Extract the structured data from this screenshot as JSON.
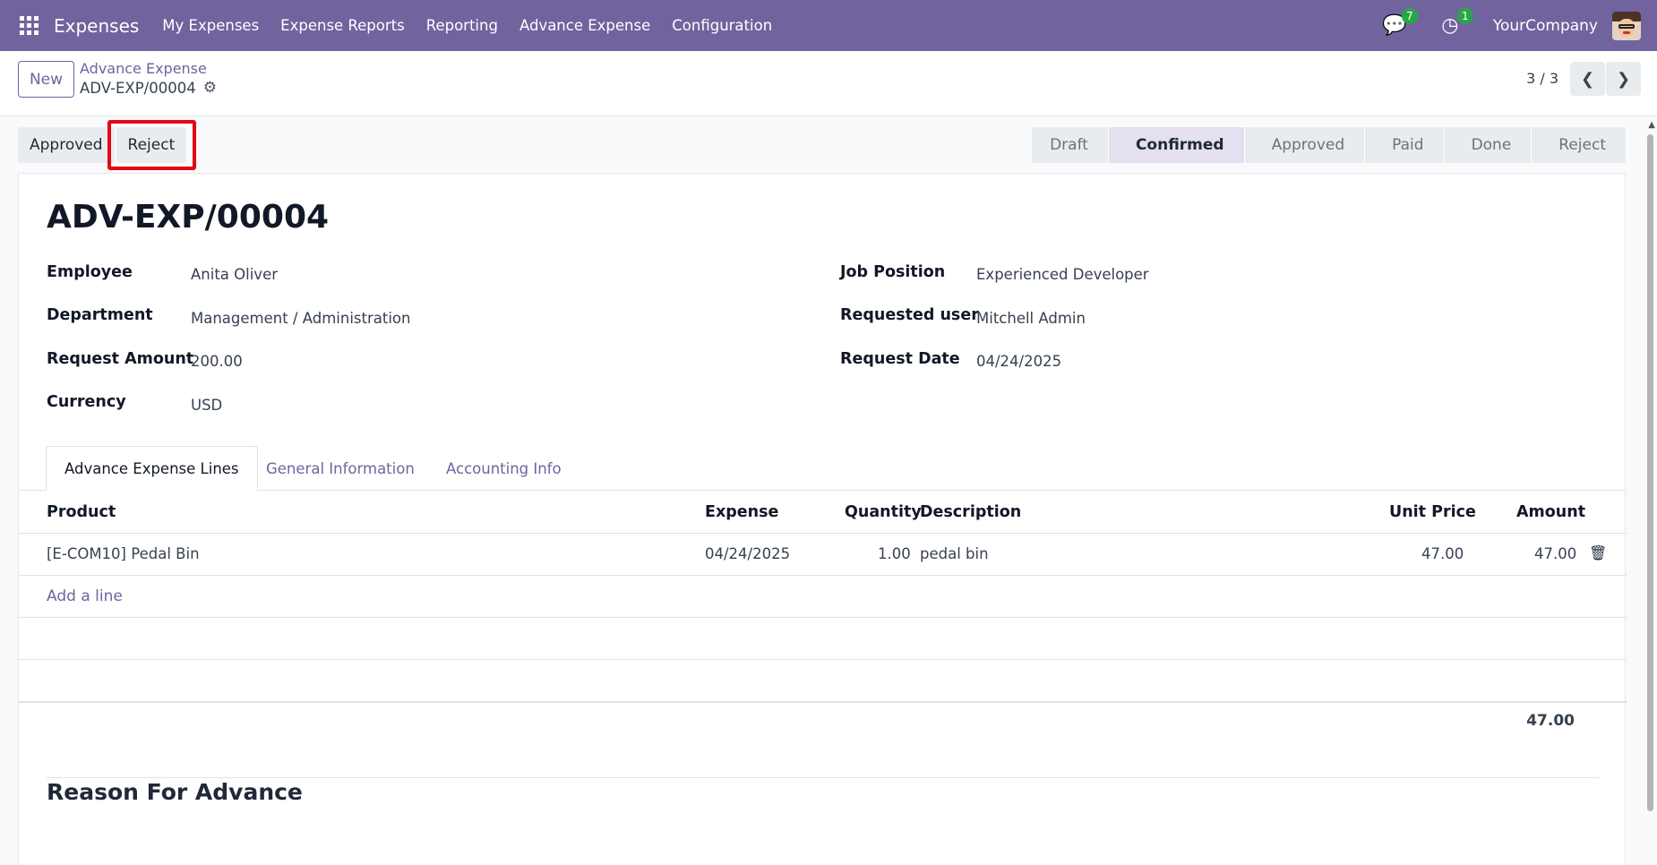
{
  "navbar": {
    "app_name": "Expenses",
    "menu": [
      "My Expenses",
      "Expense Reports",
      "Reporting",
      "Advance Expense",
      "Configuration"
    ],
    "messages_count": "7",
    "activities_count": "1",
    "company": "YourCompany",
    "color": "#71639e"
  },
  "control": {
    "new_label": "New",
    "breadcrumb_parent": "Advance Expense",
    "breadcrumb_current": "ADV-EXP/00004",
    "pager": "3 / 3"
  },
  "actions": {
    "approved_label": "Approved",
    "reject_label": "Reject"
  },
  "statusbar": {
    "stages": [
      "Draft",
      "Confirmed",
      "Approved",
      "Paid",
      "Done",
      "Reject"
    ],
    "active": "Confirmed"
  },
  "form": {
    "title": "ADV-EXP/00004",
    "left_fields": [
      {
        "label": "Employee",
        "value": "Anita Oliver"
      },
      {
        "label": "Department",
        "value": "Management / Administration"
      },
      {
        "label": "Request Amount",
        "value": "200.00"
      },
      {
        "label": "Currency",
        "value": "USD"
      }
    ],
    "right_fields": [
      {
        "label": "Job Position",
        "value": "Experienced Developer"
      },
      {
        "label": "Requested user",
        "value": "Mitchell Admin"
      },
      {
        "label": "Request Date",
        "value": "04/24/2025"
      }
    ]
  },
  "tabs": [
    "Advance Expense Lines",
    "General Information",
    "Accounting Info"
  ],
  "lines": {
    "headers": [
      "Product",
      "Expense",
      "Quantity",
      "Description",
      "Unit Price",
      "Amount"
    ],
    "rows": [
      {
        "product": "[E-COM10] Pedal Bin",
        "expense": "04/24/2025",
        "quantity": "1.00",
        "description": "pedal bin",
        "unit_price": "47.00",
        "amount": "47.00"
      }
    ],
    "add_line": "Add a line",
    "total": "47.00"
  },
  "reason_heading": "Reason For Advance"
}
